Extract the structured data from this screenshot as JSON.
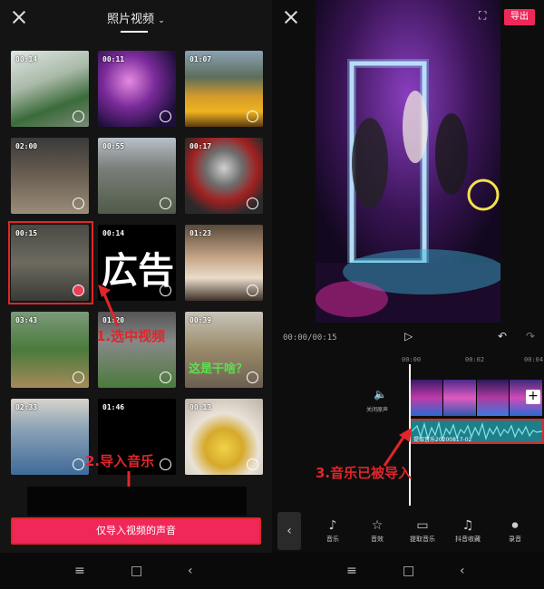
{
  "left": {
    "title": "照片视频",
    "thumbnails": [
      {
        "duration": "00:14"
      },
      {
        "duration": "00:11"
      },
      {
        "duration": "01:07"
      },
      {
        "duration": "02:00"
      },
      {
        "duration": "00:55"
      },
      {
        "duration": "00:17"
      },
      {
        "duration": "00:15",
        "selected": true
      },
      {
        "duration": "00:14"
      },
      {
        "duration": "01:23"
      },
      {
        "duration": "03:43"
      },
      {
        "duration": "01:20"
      },
      {
        "duration": "00:39"
      },
      {
        "duration": "02:33"
      },
      {
        "duration": "01:46"
      },
      {
        "duration": "00:13"
      }
    ],
    "ad_text": "広告",
    "overlay_question": "这是干啥？",
    "annotation_1": "1.选中视频",
    "annotation_2": "2.导入音乐",
    "import_button": "仅导入视频的声音"
  },
  "right": {
    "export_button": "导出",
    "timecode": "00:00/00:15",
    "ticks": [
      "00:00",
      "00:02",
      "00:04"
    ],
    "mute_label": "关闭原声",
    "audio_track_label": "提取音乐20200817-02",
    "annotation_3": "3.音乐已被导入",
    "tools": [
      {
        "label": "音乐",
        "icon": "music-icon"
      },
      {
        "label": "音效",
        "icon": "sound-effect-icon"
      },
      {
        "label": "提取音乐",
        "icon": "extract-music-icon"
      },
      {
        "label": "抖音收藏",
        "icon": "tiktok-icon"
      },
      {
        "label": "录音",
        "icon": "microphone-icon"
      }
    ]
  },
  "colors": {
    "accent": "#f02859",
    "annotation": "#e0262b",
    "audio_track": "#1e7f88"
  }
}
